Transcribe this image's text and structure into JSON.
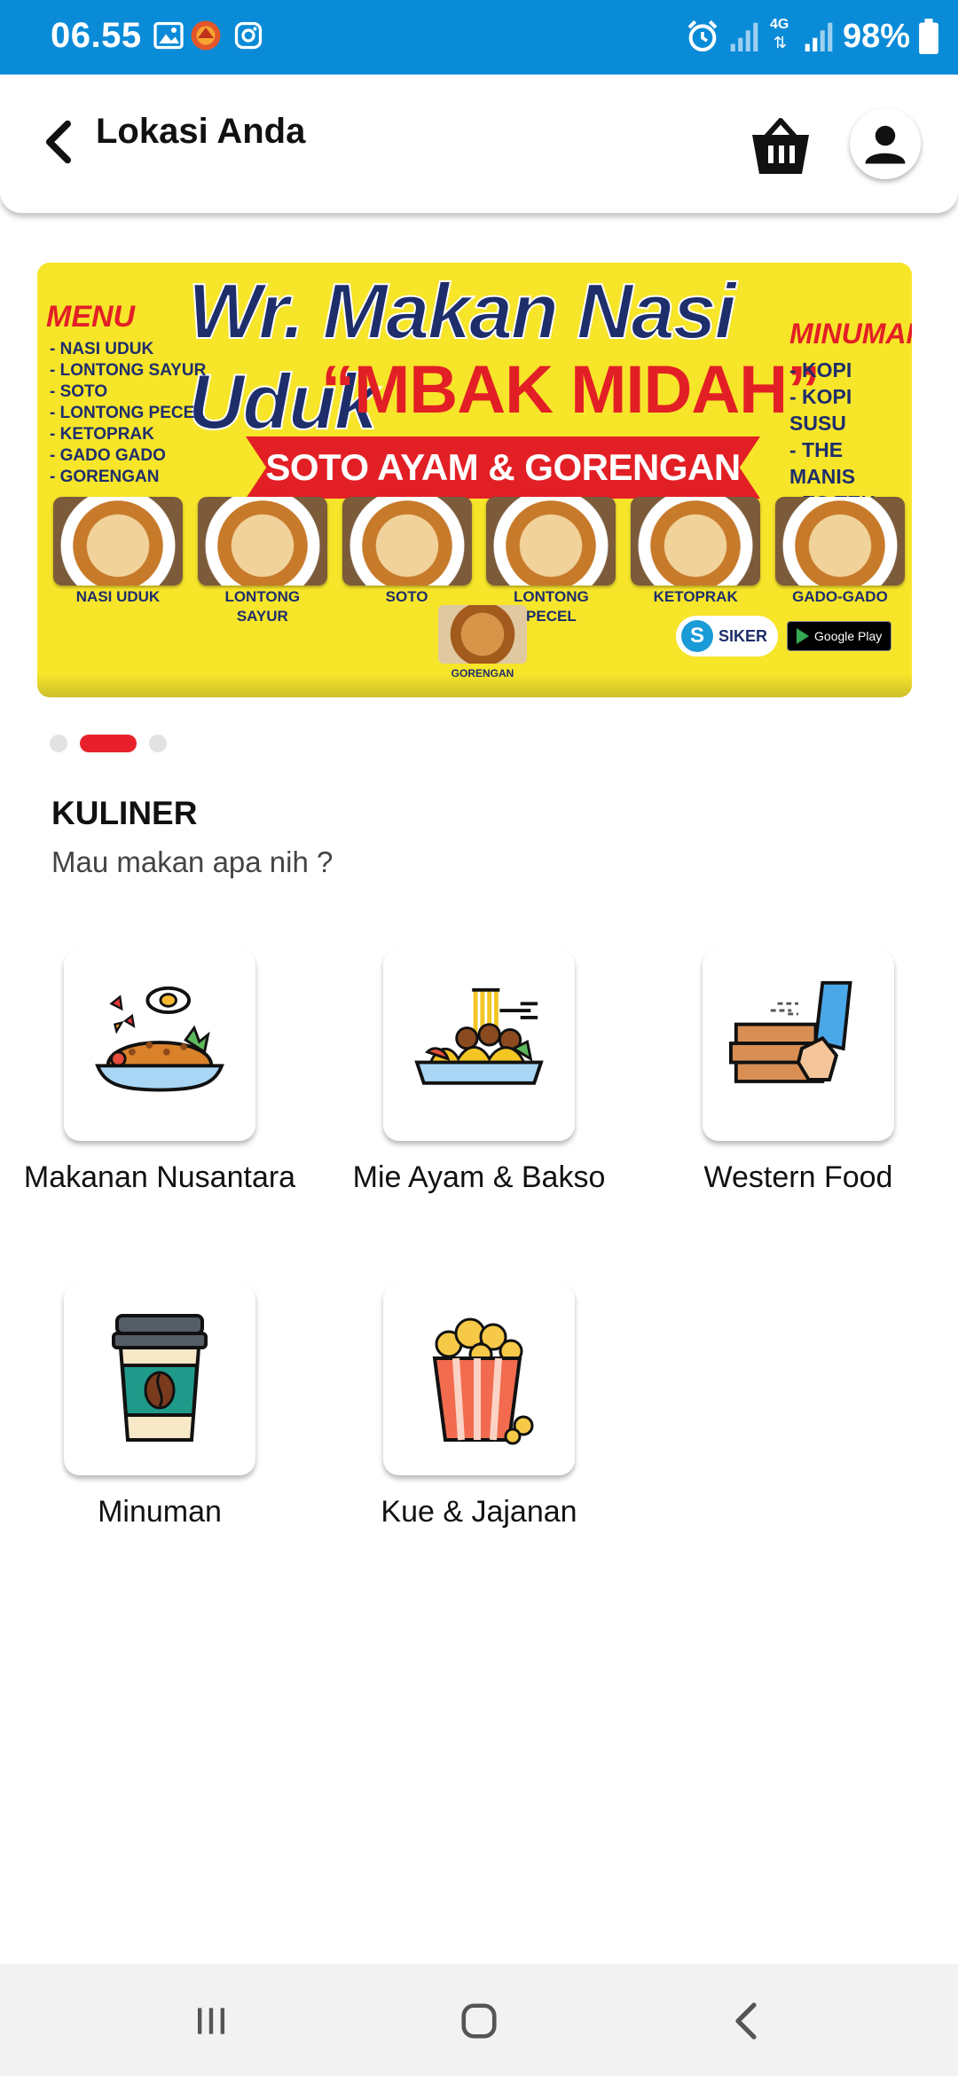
{
  "status_bar": {
    "time": "06.55",
    "battery": "98%",
    "network": "4G",
    "icons": [
      "gallery-icon",
      "app-icon",
      "instagram-icon",
      "alarm-icon",
      "signal-icon",
      "battery-icon"
    ]
  },
  "header": {
    "title": "Lokasi Anda",
    "icons": [
      "back-arrow-icon",
      "basket-icon",
      "user-icon"
    ]
  },
  "banner": {
    "title_line1": "Wr. Makan Nasi Uduk",
    "title_line2": "“MBAK MIDAH”",
    "ribbon": "SOTO AYAM & GORENGAN",
    "menu_heading": "MENU",
    "menu_items": [
      "- NASI UDUK",
      "- LONTONG SAYUR",
      "- SOTO",
      "- LONTONG PECEL",
      "- KETOPRAK",
      "- GADO GADO",
      "- GORENGAN"
    ],
    "drink_heading": "MINUMAN",
    "drink_items": [
      "- KOPI",
      "- KOPI SUSU",
      "- THE MANIS",
      "- ES TEH."
    ],
    "captions": [
      "NASI UDUK",
      "LONTONG SAYUR",
      "SOTO",
      "LONTONG PECEL",
      "KETOPRAK",
      "GADO-GADO"
    ],
    "center_caption": "GORENGAN",
    "badge_siker": "SIKER",
    "badge_store": "Google Play"
  },
  "carousel": {
    "count": 3,
    "active_index": 1
  },
  "section": {
    "title": "KULINER",
    "subtitle": "Mau makan apa nih ?"
  },
  "categories": [
    {
      "label": "Makanan Nusantara",
      "icon": "fried-rice-icon"
    },
    {
      "label": "Mie Ayam & Bakso",
      "icon": "noodle-bowl-icon"
    },
    {
      "label": "Western Food",
      "icon": "pizza-delivery-icon"
    },
    {
      "label": "Minuman",
      "icon": "coffee-cup-icon"
    },
    {
      "label": "Kue & Jajanan",
      "icon": "popcorn-icon"
    }
  ],
  "nav_bar": {
    "icons": [
      "recent-apps-icon",
      "home-icon",
      "back-icon"
    ]
  },
  "colors": {
    "status_bar": "#0a8bd8",
    "accent_red": "#e8202c",
    "banner_yellow": "#f7e52a",
    "banner_navy": "#1e2e6b"
  }
}
